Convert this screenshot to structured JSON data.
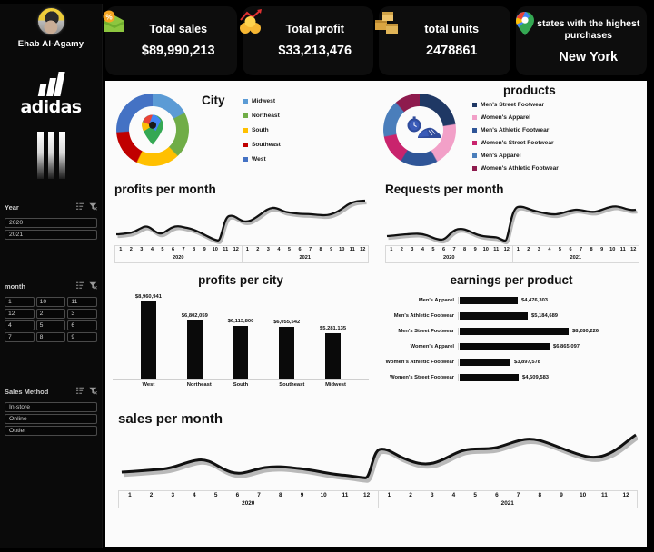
{
  "sidebar": {
    "user_name": "Ehab Al-Agamy",
    "brand": "adidas",
    "filters": [
      {
        "title": "Year",
        "name": "year",
        "sort_icon": "sort-list-icon",
        "clear_icon": "clear-filter-icon",
        "options": [
          "2020",
          "2021"
        ]
      },
      {
        "title": "month",
        "name": "month",
        "sort_icon": "sort-list-icon",
        "clear_icon": "clear-filter-icon",
        "options": [
          "1",
          "10",
          "11",
          "12",
          "2",
          "3",
          "4",
          "5",
          "6",
          "7",
          "8",
          "9"
        ]
      },
      {
        "title": "Sales Method",
        "name": "sales-method",
        "sort_icon": "sort-list-icon",
        "clear_icon": "clear-filter-icon",
        "options": [
          "In-store",
          "Online",
          "Outlet"
        ]
      }
    ]
  },
  "kpis": [
    {
      "label": "Total sales",
      "value": "$89,990,213",
      "icon": "discount-tag-icon"
    },
    {
      "label": "Total profit",
      "value": "$33,213,476",
      "icon": "profit-coins-icon"
    },
    {
      "label": "total units",
      "value": "2478861",
      "icon": "boxes-icon"
    },
    {
      "label": "states with the highest purchases",
      "value": "New York",
      "icon": "map-pin-icon"
    }
  ],
  "chart_data": [
    {
      "type": "pie",
      "name": "city-donut",
      "title": "City",
      "legend_position": "right",
      "labels": [
        "Midwest",
        "Northeast",
        "South",
        "Southeast",
        "West"
      ],
      "colors": [
        "#5b9bd5",
        "#70ad47",
        "#ffc000",
        "#c00000",
        "#4472c4"
      ],
      "values": [
        17,
        20,
        19,
        16,
        28
      ],
      "center_icon": "map-pin-icon"
    },
    {
      "type": "pie",
      "name": "products-donut",
      "title": "products",
      "legend_position": "right",
      "labels": [
        "Men's Street Footwear",
        "Women's Apparel",
        "Men's Athletic Footwear",
        "Women's Street Footwear",
        "Men's Apparel",
        "Women's Athletic Footwear"
      ],
      "colors": [
        "#1f3864",
        "#f2a0c8",
        "#2f5597",
        "#c9246d",
        "#4a7ebb",
        "#8e1b4e"
      ],
      "values": [
        23,
        19,
        16,
        13,
        17,
        12
      ],
      "center_icon": "shoe-stopwatch-icon"
    },
    {
      "type": "line",
      "name": "profits-per-month",
      "title": "profits per month",
      "xlabel": "",
      "ylabel": "",
      "groups": [
        "2020",
        "2021"
      ],
      "categories": [
        "1",
        "2",
        "3",
        "4",
        "5",
        "6",
        "7",
        "8",
        "9",
        "10",
        "11",
        "12",
        "1",
        "2",
        "3",
        "4",
        "5",
        "6",
        "7",
        "8",
        "9",
        "10",
        "11",
        "12"
      ],
      "values": [
        22,
        23,
        26,
        33,
        27,
        21,
        27,
        30,
        28,
        26,
        23,
        19,
        52,
        47,
        42,
        45,
        52,
        60,
        64,
        58,
        56,
        56,
        58,
        70
      ]
    },
    {
      "type": "line",
      "name": "requests-per-month",
      "title": "Requests per month",
      "xlabel": "",
      "ylabel": "",
      "groups": [
        "2020",
        "2021"
      ],
      "categories": [
        "1",
        "2",
        "3",
        "4",
        "5",
        "6",
        "7",
        "8",
        "9",
        "10",
        "11",
        "12",
        "1",
        "2",
        "3",
        "4",
        "5",
        "6",
        "7",
        "8",
        "9",
        "10",
        "11",
        "12"
      ],
      "values": [
        20,
        21,
        23,
        24,
        22,
        16,
        24,
        30,
        26,
        25,
        24,
        18,
        62,
        56,
        52,
        50,
        54,
        50,
        56,
        62,
        60,
        52,
        50,
        56
      ]
    },
    {
      "type": "bar",
      "name": "profits-per-city",
      "title": "profits per city",
      "orientation": "vertical",
      "categories": [
        "West",
        "Northeast",
        "South",
        "Southeast",
        "Midwest"
      ],
      "values": [
        8960941,
        6802059,
        6113800,
        6055542,
        5281135
      ],
      "value_labels": [
        "$8,960,941",
        "$6,802,059",
        "$6,113,800",
        "$6,055,542",
        "$5,281,135"
      ]
    },
    {
      "type": "bar",
      "name": "earnings-per-product",
      "title": "earnings per product",
      "orientation": "horizontal",
      "categories": [
        "Men's Apparel",
        "Men's Athletic Footwear",
        "Men's Street Footwear",
        "Women's Apparel",
        "Women's Athletic Footwear",
        "Women's Street Footwear"
      ],
      "values": [
        4476303,
        5184689,
        8280226,
        6865097,
        3897578,
        4509583
      ],
      "value_labels": [
        "$4,476,303",
        "$5,184,689",
        "$8,280,226",
        "$6,865,097",
        "$3,897,578",
        "$4,509,583"
      ]
    },
    {
      "type": "line",
      "name": "sales-per-month",
      "title": "sales per month",
      "xlabel": "",
      "ylabel": "",
      "groups": [
        "2020",
        "2021"
      ],
      "categories": [
        "1",
        "2",
        "3",
        "4",
        "5",
        "6",
        "7",
        "8",
        "9",
        "10",
        "11",
        "12",
        "1",
        "2",
        "3",
        "4",
        "5",
        "6",
        "7",
        "8",
        "9",
        "10",
        "11",
        "12"
      ],
      "values": [
        22,
        23,
        27,
        36,
        30,
        18,
        27,
        28,
        27,
        24,
        21,
        17,
        58,
        48,
        42,
        46,
        56,
        62,
        68,
        62,
        58,
        52,
        56,
        72
      ]
    }
  ]
}
